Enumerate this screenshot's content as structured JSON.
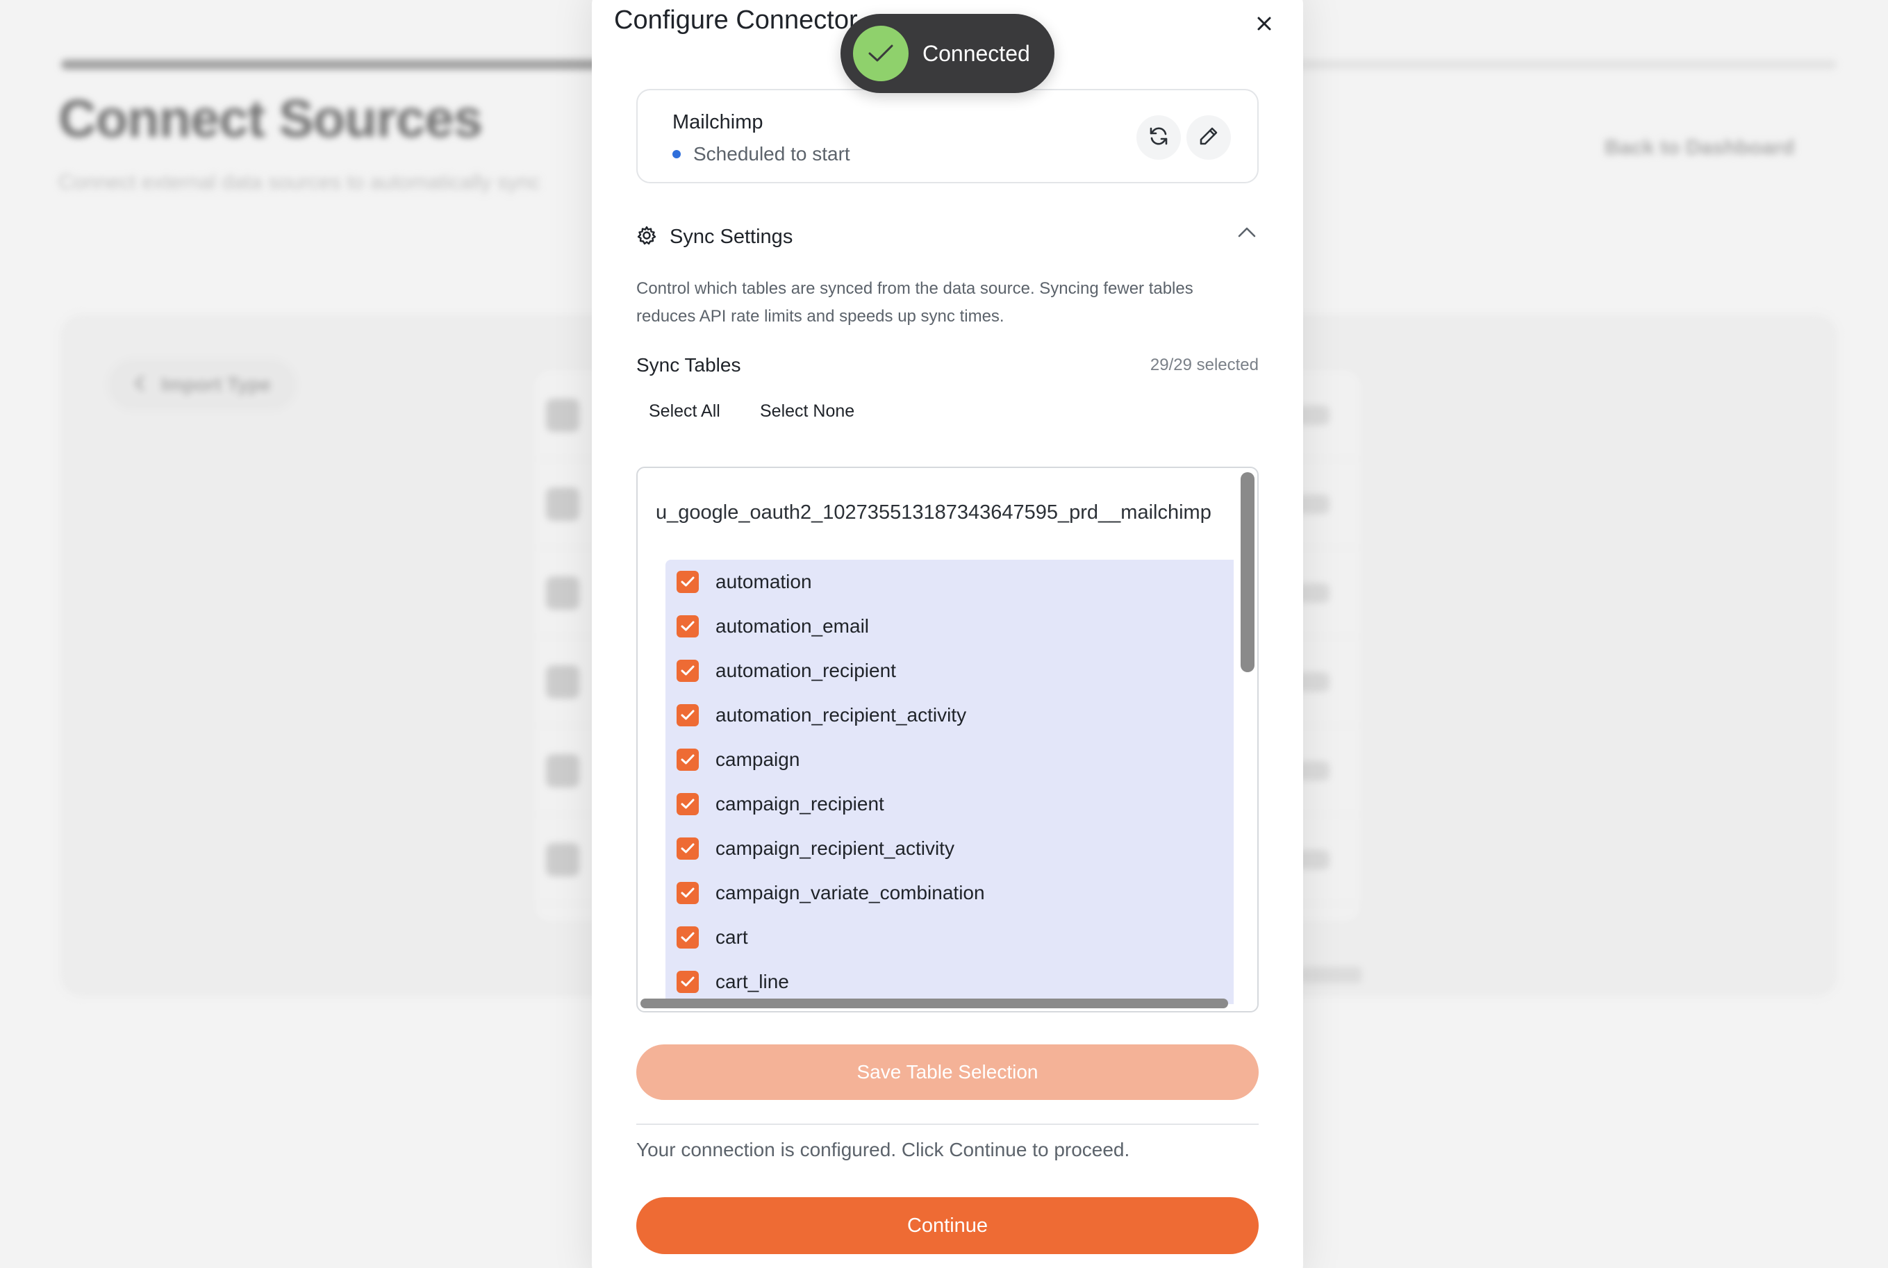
{
  "background": {
    "title": "Connect Sources",
    "subtitle": "Connect external data sources to automatically sync",
    "back_link": "Back to Dashboard",
    "import_type_button": "Import Type"
  },
  "modal": {
    "title": "Configure Connector",
    "connection": {
      "name": "Mailchimp",
      "status": "Scheduled to start"
    },
    "sync_settings": {
      "header": "Sync Settings",
      "description": "Control which tables are synced from the data source. Syncing fewer tables reduces API rate limits and speeds up sync times.",
      "tables_label": "Sync Tables",
      "selected_count": "29/29 selected",
      "select_all": "Select All",
      "select_none": "Select None",
      "schema_name": "u_google_oauth2_102735513187343647595_prd__mailchimp",
      "tables": [
        {
          "name": "automation",
          "checked": true
        },
        {
          "name": "automation_email",
          "checked": true
        },
        {
          "name": "automation_recipient",
          "checked": true
        },
        {
          "name": "automation_recipient_activity",
          "checked": true
        },
        {
          "name": "campaign",
          "checked": true
        },
        {
          "name": "campaign_recipient",
          "checked": true
        },
        {
          "name": "campaign_recipient_activity",
          "checked": true
        },
        {
          "name": "campaign_variate_combination",
          "checked": true
        },
        {
          "name": "cart",
          "checked": true
        },
        {
          "name": "cart_line",
          "checked": true
        }
      ],
      "save_button": "Save Table Selection"
    },
    "configured_message": "Your connection is configured. Click Continue to proceed.",
    "continue_button": "Continue"
  },
  "toast": {
    "text": "Connected",
    "icon": "check-icon"
  },
  "colors": {
    "accent": "#ee6b34",
    "accent_disabled": "#f4b297",
    "list_highlight": "#e3e6f9",
    "status_dot": "#2f6fdb",
    "toast_bg": "#3a3a3c",
    "toast_icon_bg": "#8fd16c"
  }
}
